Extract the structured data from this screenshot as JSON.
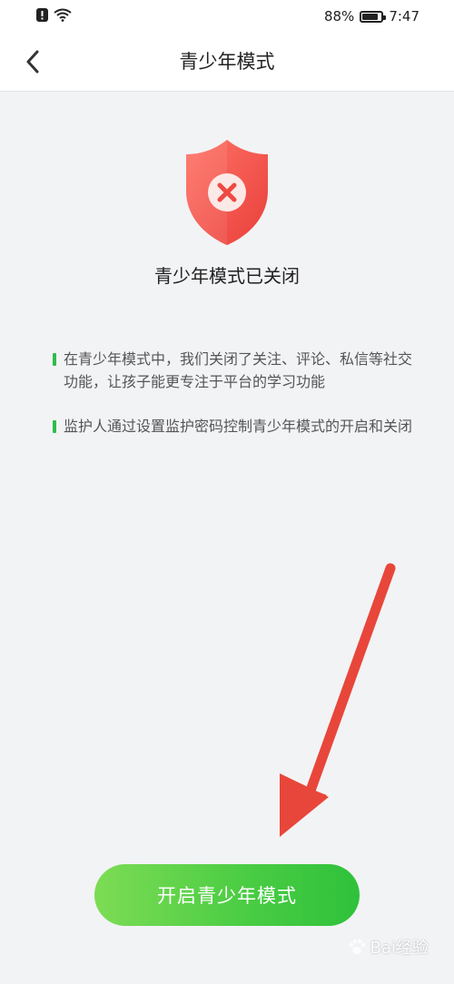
{
  "status_bar": {
    "battery_percent": "88%",
    "time": "7:47",
    "battery_level": 0.88
  },
  "nav": {
    "title": "青少年模式"
  },
  "status": {
    "title": "青少年模式已关闭"
  },
  "info_items": [
    "在青少年模式中，我们关闭了关注、评论、私信等社交功能，让孩子能更专注于平台的学习功能",
    "监护人通过设置监护密码控制青少年模式的开启和关闭"
  ],
  "cta": {
    "label": "开启青少年模式"
  },
  "watermark": {
    "text": "Bai经验"
  },
  "colors": {
    "accent_green": "#2ebd4a",
    "shield_red": "#f0534c",
    "annotation_arrow": "#e8463a"
  }
}
